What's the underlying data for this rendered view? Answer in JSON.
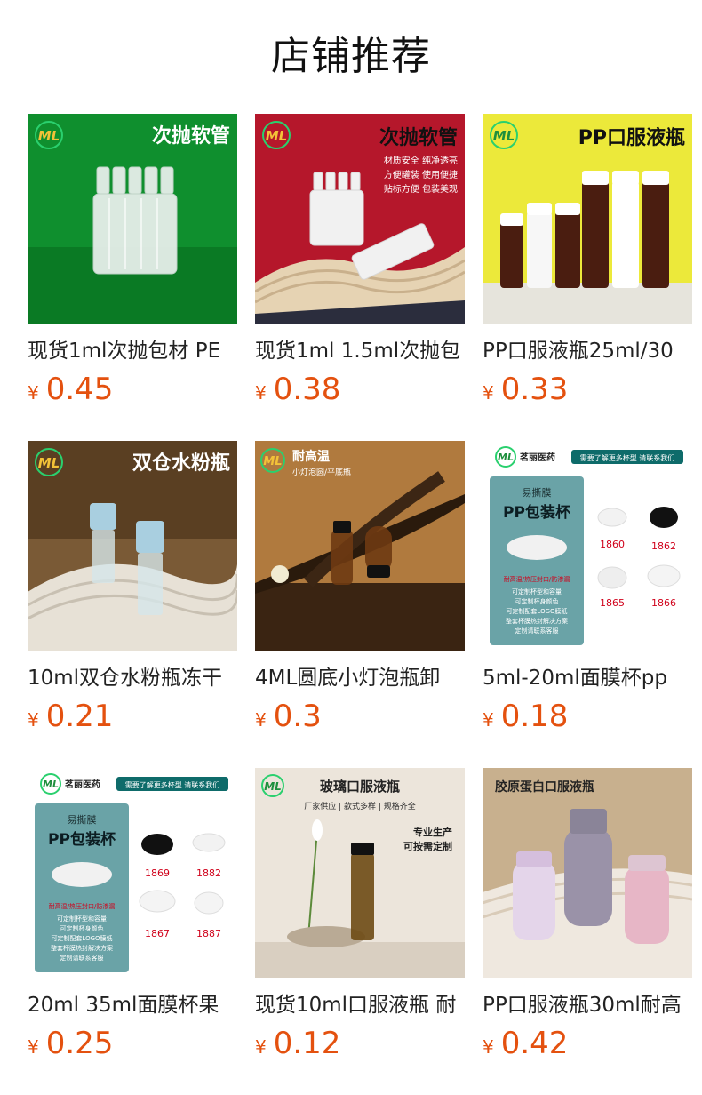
{
  "page": {
    "title": "店铺推荐"
  },
  "brand": {
    "price_color": "#e4510f",
    "logo_text": "ML"
  },
  "products": [
    {
      "name": "现货1ml次抛包材 PE",
      "currency": "¥",
      "price": "0.45",
      "image": {
        "headline": "次抛软管",
        "lines": [],
        "tags": [],
        "sizes": []
      }
    },
    {
      "name": "现货1ml 1.5ml次抛包",
      "currency": "¥",
      "price": "0.38",
      "image": {
        "headline": "次抛软管",
        "lines": [
          "材质安全 纯净透亮",
          "方便罐装 使用便捷",
          "贴标方便 包装美观"
        ],
        "tags": [],
        "sizes": []
      }
    },
    {
      "name": "PP口服液瓶25ml/30",
      "currency": "¥",
      "price": "0.33",
      "image": {
        "headline": "PP口服液瓶",
        "lines": [],
        "tags": [],
        "sizes": []
      }
    },
    {
      "name": "10ml双仓水粉瓶冻干",
      "currency": "¥",
      "price": "0.21",
      "image": {
        "headline": "双仓水粉瓶",
        "lines": [],
        "tags": [],
        "sizes": []
      }
    },
    {
      "name": "4ML圆底小灯泡瓶卸",
      "currency": "¥",
      "price": "0.3",
      "image": {
        "headline": "耐高温",
        "lines": [
          "小灯泡圆/平底瓶"
        ],
        "tags": [],
        "sizes": []
      }
    },
    {
      "name": "5ml-20ml面膜杯pp",
      "currency": "¥",
      "price": "0.18",
      "image": {
        "headline": "PP包装杯",
        "brand_name": "茗丽医药",
        "banner": "需要了解更多杯型 请联系我们",
        "subhead": "易撕膜",
        "lines": [
          "可定制杯型和容量",
          "可定制杯身颜色",
          "可定制配套LOGO膜纸",
          "整套杯膜热封解决方案",
          "定制请联系客服"
        ],
        "tags": [
          "耐高温/热压封口/防渗漏"
        ],
        "sizes": [
          "1860",
          "1862",
          "1865",
          "1866"
        ]
      }
    },
    {
      "name": "20ml 35ml面膜杯果",
      "currency": "¥",
      "price": "0.25",
      "image": {
        "headline": "PP包装杯",
        "brand_name": "茗丽医药",
        "banner": "需要了解更多杯型 请联系我们",
        "subhead": "易撕膜",
        "lines": [
          "可定制杯型和容量",
          "可定制杯身颜色",
          "可定制配套LOGO膜纸",
          "整套杯膜热封解决方案",
          "定制请联系客服"
        ],
        "tags": [
          "耐高温/热压封口/防渗漏"
        ],
        "sizes": [
          "1869",
          "1882",
          "1867",
          "1887"
        ]
      }
    },
    {
      "name": "现货10ml口服液瓶 耐",
      "currency": "¥",
      "price": "0.12",
      "image": {
        "headline": "玻璃口服液瓶",
        "lines": [
          "厂家供应 | 款式多样 | 规格齐全",
          "专业生产",
          "可按需定制"
        ],
        "tags": [],
        "sizes": []
      }
    },
    {
      "name": "PP口服液瓶30ml耐高",
      "currency": "¥",
      "price": "0.42",
      "image": {
        "headline": "胶原蛋白口服液瓶",
        "lines": [],
        "tags": [],
        "sizes": []
      }
    }
  ]
}
